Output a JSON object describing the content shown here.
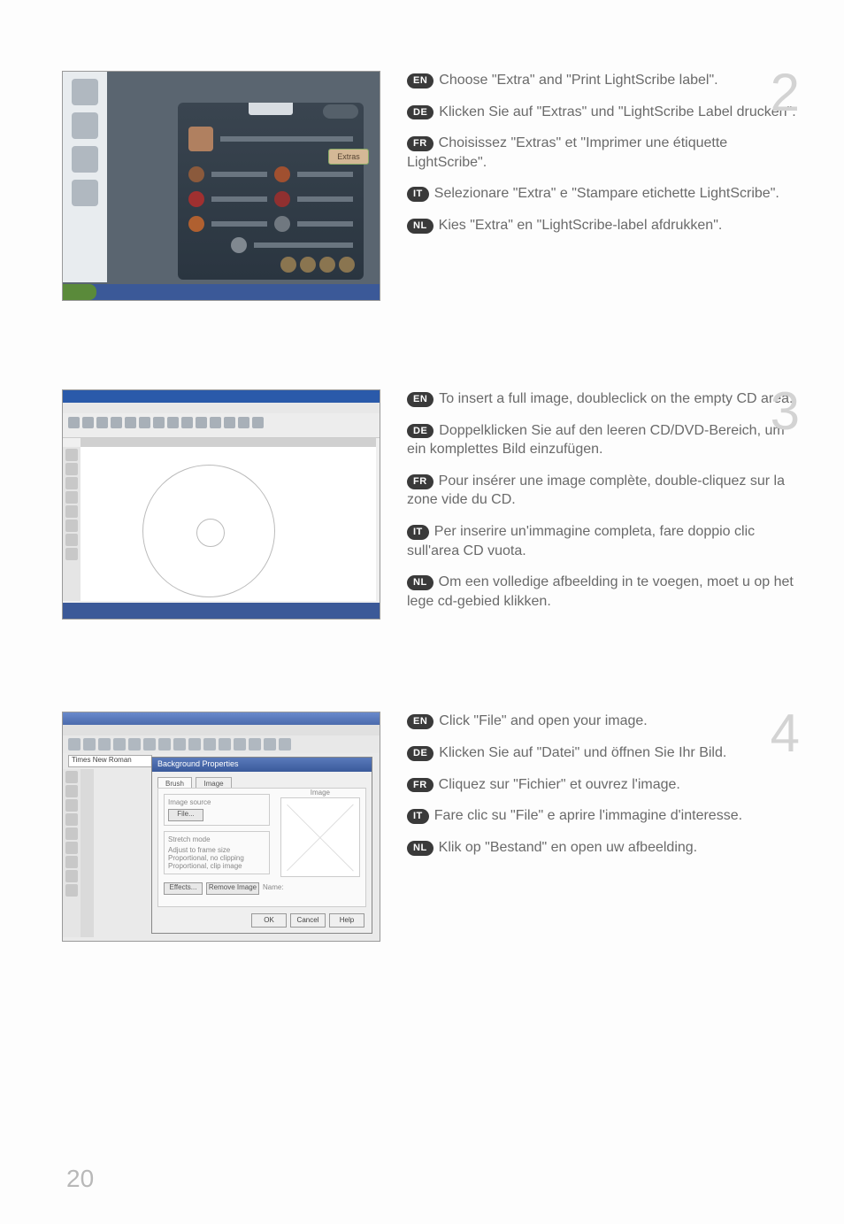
{
  "page_number": "20",
  "steps": [
    {
      "number": "2",
      "screenshot": {
        "extras_label": "Extras",
        "alt": "nero-smartstart-extras"
      },
      "instructions": [
        {
          "lang": "EN",
          "text": "Choose \"Extra\" and \"Print LightScribe label\"."
        },
        {
          "lang": "DE",
          "text": "Klicken Sie auf \"Extras\" und \"LightScribe Label drucken\"."
        },
        {
          "lang": "FR",
          "text": "Choisissez \"Extras\" et \"Imprimer une étiquette LightScribe\"."
        },
        {
          "lang": "IT",
          "text": "Selezionare \"Extra\" e \"Stampare etichette LightScribe\"."
        },
        {
          "lang": "NL",
          "text": "Kies \"Extra\" en \"LightScribe-label afdrukken\"."
        }
      ]
    },
    {
      "number": "3",
      "screenshot": {
        "alt": "nero-cover-designer-empty"
      },
      "instructions": [
        {
          "lang": "EN",
          "text": "To insert a full image, doubleclick on the empty CD area."
        },
        {
          "lang": "DE",
          "text": "Doppelklicken Sie auf den leeren CD/DVD-Bereich, um ein komplettes Bild einzufügen."
        },
        {
          "lang": "FR",
          "text": "Pour insérer une image complète, double-cliquez sur la zone vide du CD."
        },
        {
          "lang": "IT",
          "text": "Per inserire un'immagine completa, fare doppio clic sull'area CD vuota."
        },
        {
          "lang": "NL",
          "text": "Om een volledige afbeelding in te voegen, moet u op het lege cd-gebied klikken."
        }
      ]
    },
    {
      "number": "4",
      "screenshot": {
        "font_name": "Times New Roman",
        "dialog_title": "Background Properties",
        "tab_brush": "Brush",
        "tab_image": "Image",
        "group_source": "Image source",
        "file_button": "File...",
        "group_stretch": "Stretch mode",
        "opt1": "Adjust to frame size",
        "opt2": "Proportional, no clipping",
        "opt3": "Proportional, clip image",
        "effects": "Effects...",
        "remove": "Remove Image",
        "name_label": "Name:",
        "preview_label": "Image",
        "ok": "OK",
        "cancel": "Cancel",
        "help": "Help",
        "alt": "background-properties-dialog"
      },
      "instructions": [
        {
          "lang": "EN",
          "text": "Click \"File\" and open your image."
        },
        {
          "lang": "DE",
          "text": "Klicken Sie auf \"Datei\" und öffnen Sie Ihr Bild."
        },
        {
          "lang": "FR",
          "text": "Cliquez sur \"Fichier\" et ouvrez l'image."
        },
        {
          "lang": "IT",
          "text": "Fare clic su \"File\" e aprire l'immagine d'interesse."
        },
        {
          "lang": "NL",
          "text": "Klik op \"Bestand\" en open uw afbeelding."
        }
      ]
    }
  ]
}
